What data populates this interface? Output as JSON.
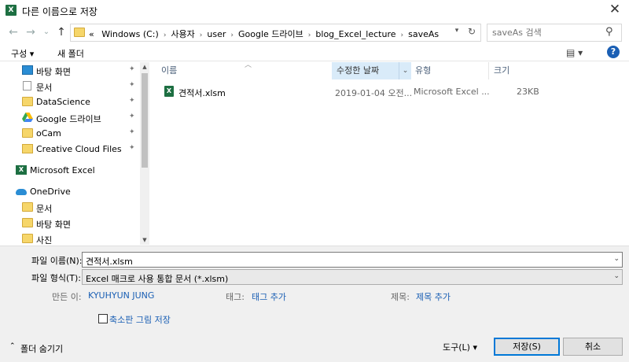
{
  "window": {
    "title": "다른 이름으로 저장",
    "app_icon": "excel-icon",
    "close_glyph": "✕"
  },
  "nav": {
    "back_glyph": "←",
    "forward_glyph": "→",
    "recent_glyph": "⌄",
    "up_glyph": "↑",
    "address_prefix": "«",
    "breadcrumbs": [
      "Windows (C:)",
      "사용자",
      "user",
      "Google 드라이브",
      "blog_Excel_lecture",
      "saveAs"
    ],
    "search_placeholder": "saveAs 검색"
  },
  "toolbar": {
    "organize_label": "구성 ▾",
    "new_folder_label": "새 폴더",
    "view_glyph": "▤ ▾",
    "help_glyph": "?"
  },
  "sidebar": {
    "items": [
      {
        "label": "바탕 화면",
        "icon": "desktop-icon",
        "pinned": true
      },
      {
        "label": "문서",
        "icon": "document-icon",
        "pinned": true
      },
      {
        "label": "DataScience",
        "icon": "folder-icon",
        "pinned": true
      },
      {
        "label": "Google 드라이브",
        "icon": "google-drive-icon",
        "pinned": true
      },
      {
        "label": "oCam",
        "icon": "folder-icon",
        "pinned": true
      },
      {
        "label": "Creative Cloud Files",
        "icon": "creative-cloud-icon",
        "pinned": true
      },
      {
        "label": "Microsoft Excel",
        "icon": "excel-icon",
        "pinned": false
      },
      {
        "label": "OneDrive",
        "icon": "onedrive-icon",
        "pinned": false
      },
      {
        "label": "문서",
        "icon": "folder-icon",
        "pinned": false
      },
      {
        "label": "바탕 화면",
        "icon": "folder-icon",
        "pinned": false
      },
      {
        "label": "사진",
        "icon": "folder-icon",
        "pinned": false
      }
    ],
    "pin_glyph": "📌"
  },
  "files": {
    "columns": [
      "이름",
      "수정한 날짜",
      "유형",
      "크기"
    ],
    "rows": [
      {
        "name": "견적서.xlsm",
        "date": "2019-01-04 오전...",
        "type": "Microsoft Excel ...",
        "size": "23KB"
      }
    ]
  },
  "form": {
    "filename_label": "파일 이름(N):",
    "filename_value": "견적서.xlsm",
    "filetype_label": "파일 형식(T):",
    "filetype_value": "Excel 매크로 사용 통합 문서 (*.xlsm)",
    "author_label": "만든 이:",
    "author_value": "KYUHYUN JUNG",
    "tags_label": "태그:",
    "tags_value": "태그 추가",
    "title_label": "제목:",
    "title_value": "제목 추가",
    "thumbnail_label": "축소판 그림 저장",
    "hide_folders_label": "폴더 숨기기",
    "tools_label": "도구(L) ▾",
    "save_label": "저장(S)",
    "cancel_label": "취소"
  },
  "colors": {
    "accent": "#0078d7",
    "link": "#1a5fb4",
    "excel_green": "#1d6f42",
    "folder_yellow": "#f6d66a"
  }
}
